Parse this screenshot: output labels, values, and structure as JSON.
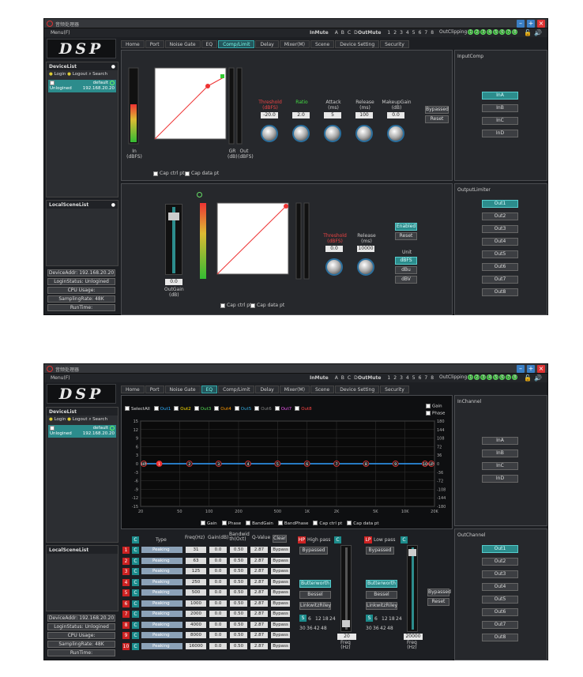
{
  "window": {
    "title": "音频处理器",
    "menu": "Menu(F)"
  },
  "mute": {
    "in_label": "InMute",
    "in_channels": [
      "A",
      "B",
      "C",
      "D"
    ],
    "out_label": "OutMute",
    "out_channels": [
      "1",
      "2",
      "3",
      "4",
      "5",
      "6",
      "7",
      "8"
    ],
    "clip_label": "OutClipping",
    "clip_leds": [
      "1",
      "2",
      "3",
      "4",
      "5",
      "6",
      "7",
      "8"
    ]
  },
  "logo": "DSP",
  "tabs": [
    "Home",
    "Port",
    "Noise Gate",
    "EQ",
    "Comp/Limit",
    "Delay",
    "Mixer(M)",
    "Scene",
    "Device Setting",
    "Security"
  ],
  "sidebar": {
    "device_list": "DeviceList",
    "login": "Login",
    "logout": "Logout",
    "search": "Search",
    "device_name": "default",
    "device_status": "Unlogined",
    "device_ip": "192.168.20.20",
    "local_scene": "LocalSceneList",
    "status": [
      "DeviceAddr: 192.168.20.20",
      "LoginStatus: Unlogined",
      "CPU Usage:",
      "SamplingRate: 48K",
      "RunTime:"
    ]
  },
  "comp": {
    "in_label": "In\n(dBFS)",
    "gr_label": "GR\n(dB)",
    "out_label": "Out\n(dBFS)",
    "cap_ctrl": "Cap ctrl pt",
    "cap_data": "Cap data pt",
    "params": [
      {
        "name": "Threshold",
        "unit": "(dBFS)",
        "value": "-20.0",
        "color": "red"
      },
      {
        "name": "Ratio",
        "unit": "",
        "value": "2.0",
        "color": "grn"
      },
      {
        "name": "Attack",
        "unit": "(ms)",
        "value": "5",
        "color": ""
      },
      {
        "name": "Release",
        "unit": "(ms)",
        "value": "100",
        "color": ""
      },
      {
        "name": "MakeupGain",
        "unit": "(dB)",
        "value": "0.0",
        "color": ""
      }
    ],
    "bypassed": "Bypassed",
    "reset": "Reset",
    "scale": [
      "0",
      "-6",
      "-12",
      "-18",
      "-24",
      "-30",
      "-36",
      "-42",
      "-48",
      "-54",
      "-60",
      "-66",
      "-72",
      "-78",
      "-84"
    ],
    "xscale": [
      "-84",
      "-72",
      "-60",
      "-48",
      "-36",
      "-24",
      "-12",
      "0"
    ]
  },
  "input_comp": {
    "title": "InputComp",
    "items": [
      "InA",
      "InB",
      "InC",
      "InD"
    ],
    "active": 0
  },
  "limiter": {
    "outgain_value": "0.0",
    "outgain_label": "OutGain\n(dB)",
    "params": [
      {
        "name": "Threshold",
        "unit": "(dBFS)",
        "value": "0.0",
        "color": "red"
      },
      {
        "name": "Release",
        "unit": "(ms)",
        "value": "10000",
        "color": ""
      }
    ],
    "enabled": "Enabled",
    "reset": "Reset",
    "unit": "Unit",
    "units": [
      "dBFS",
      "dBu",
      "dBV"
    ]
  },
  "output_limiter": {
    "title": "OutputLimiter",
    "items": [
      "Out1",
      "Out2",
      "Out3",
      "Out4",
      "Out5",
      "Out6",
      "Out7",
      "Out8"
    ],
    "active": 0
  },
  "eq": {
    "select_all": "SelectAll",
    "outs": [
      "Out1",
      "Out2",
      "Out3",
      "Out4",
      "Out5",
      "Out6",
      "Out7",
      "Out8"
    ],
    "out_colors": [
      "#2fb0ff",
      "#ffe000",
      "#55dd55",
      "#ff9900",
      "#3ad",
      "#888",
      "#e5e",
      "#f44"
    ],
    "gain_cb": "Gain",
    "phase_cb": "Phase",
    "bottom_cbs": [
      "Gain",
      "Phase",
      "BandGain",
      "BandPhase",
      "Cap ctrl pt",
      "Cap data pt"
    ],
    "yleft": [
      "15",
      "12",
      "9",
      "6",
      "3",
      "0",
      "-3",
      "-6",
      "-9",
      "-12",
      "-15"
    ],
    "yright": [
      "180",
      "144",
      "108",
      "72",
      "36",
      "0",
      "-36",
      "-72",
      "-108",
      "-144",
      "-180"
    ],
    "xticks": [
      "20",
      "50",
      "100",
      "200",
      "500",
      "1K",
      "2K",
      "5K",
      "10K",
      "20K"
    ],
    "band_points": [
      "HP",
      "1",
      "2",
      "3",
      "4",
      "5",
      "6",
      "7",
      "8",
      "9",
      "10",
      "LP"
    ],
    "headers": {
      "type": "Type",
      "freq": "Freq(Hz)",
      "gain": "Gain(dB)",
      "bw": "Bandwid th(Oct)",
      "q": "Q-Value",
      "clear": "Clear"
    },
    "bands": [
      {
        "n": "1",
        "type": "Peaking",
        "freq": "31",
        "gain": "0.0",
        "bw": "0.50",
        "q": "2.87",
        "byp": "Bypass"
      },
      {
        "n": "2",
        "type": "Peaking",
        "freq": "63",
        "gain": "0.0",
        "bw": "0.50",
        "q": "2.87",
        "byp": "Bypass"
      },
      {
        "n": "3",
        "type": "Peaking",
        "freq": "125",
        "gain": "0.0",
        "bw": "0.50",
        "q": "2.87",
        "byp": "Bypass"
      },
      {
        "n": "4",
        "type": "Peaking",
        "freq": "250",
        "gain": "0.0",
        "bw": "0.50",
        "q": "2.87",
        "byp": "Bypass"
      },
      {
        "n": "5",
        "type": "Peaking",
        "freq": "500",
        "gain": "0.0",
        "bw": "0.50",
        "q": "2.87",
        "byp": "Bypass"
      },
      {
        "n": "6",
        "type": "Peaking",
        "freq": "1000",
        "gain": "0.0",
        "bw": "0.50",
        "q": "2.87",
        "byp": "Bypass"
      },
      {
        "n": "7",
        "type": "Peaking",
        "freq": "2000",
        "gain": "0.0",
        "bw": "0.50",
        "q": "2.87",
        "byp": "Bypass"
      },
      {
        "n": "8",
        "type": "Peaking",
        "freq": "4000",
        "gain": "0.0",
        "bw": "0.50",
        "q": "2.87",
        "byp": "Bypass"
      },
      {
        "n": "9",
        "type": "Peaking",
        "freq": "8000",
        "gain": "0.0",
        "bw": "0.50",
        "q": "2.87",
        "byp": "Bypass"
      },
      {
        "n": "10",
        "type": "Peaking",
        "freq": "16000",
        "gain": "0.0",
        "bw": "0.50",
        "q": "2.87",
        "byp": "Bypass"
      }
    ],
    "hp": {
      "tag": "HP",
      "label": "High pass",
      "bypassed": "Bypassed",
      "types": [
        "Butterworth",
        "Bessel",
        "LinkwitzRiley"
      ],
      "slopes1": [
        "6",
        "12",
        "18",
        "24"
      ],
      "slopes2": [
        "30",
        "36",
        "42",
        "48"
      ],
      "freq": "20",
      "freq_label": "Freq\n(Hz)"
    },
    "lp": {
      "tag": "LP",
      "label": "Low pass",
      "bypassed": "Bypassed",
      "types": [
        "Butterworth",
        "Bessel",
        "LinkwitzRiley"
      ],
      "slopes1": [
        "6",
        "12",
        "18",
        "24"
      ],
      "slopes2": [
        "30",
        "36",
        "42",
        "48"
      ],
      "freq": "20000",
      "freq_label": "Freq\n(Hz)"
    },
    "bypassed": "Bypassed",
    "reset": "Reset"
  },
  "in_channel": {
    "title": "InChannel",
    "items": [
      "InA",
      "InB",
      "InC",
      "InD"
    ]
  },
  "out_channel": {
    "title": "OutChannel",
    "items": [
      "Out1",
      "Out2",
      "Out3",
      "Out4",
      "Out5",
      "Out6",
      "Out7",
      "Out8"
    ],
    "active": 0
  },
  "colors": {
    "accent": "#2c8c8c",
    "curve": "#2fa0ff",
    "point": "#e33"
  }
}
